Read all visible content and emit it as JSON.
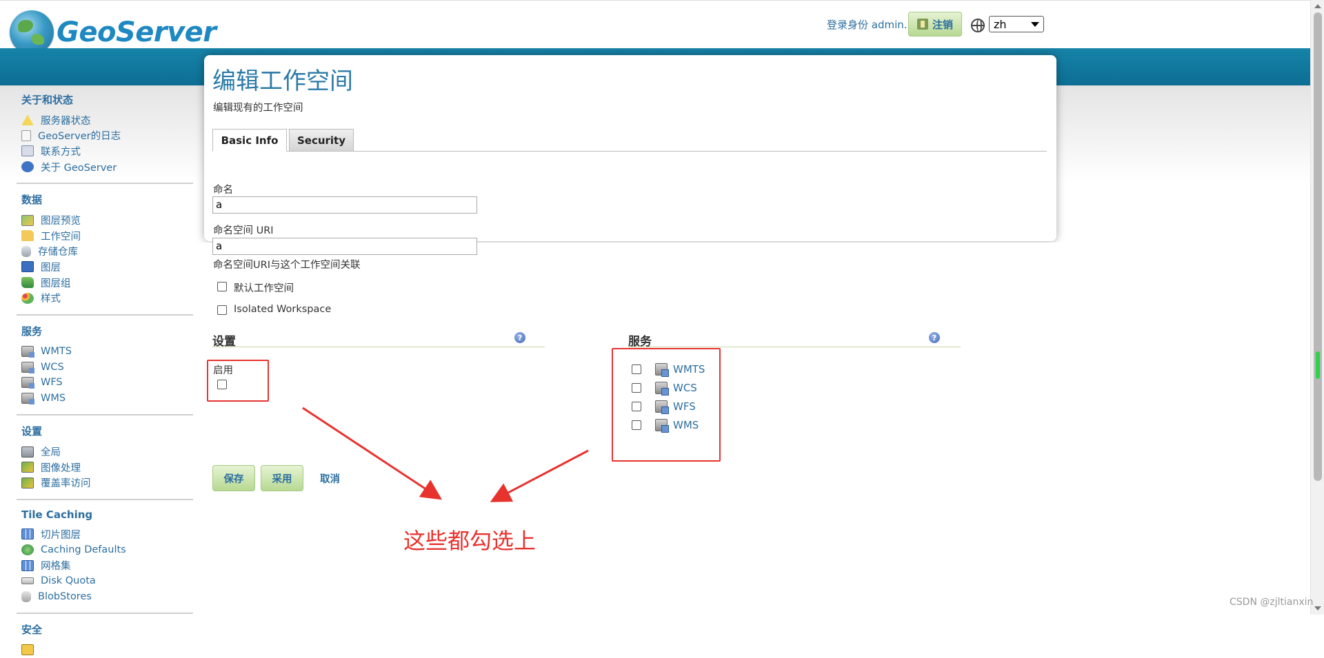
{
  "header": {
    "logo_text": "GeoServer",
    "login_text": "登录身份 admin.",
    "logout_label": "注销",
    "language_value": "zh"
  },
  "sidebar": {
    "sections": [
      {
        "title": "关于和状态",
        "items": [
          {
            "label": "服务器状态",
            "icon": "warning-icon"
          },
          {
            "label": "GeoServer的日志",
            "icon": "document-icon"
          },
          {
            "label": "联系方式",
            "icon": "contact-card-icon"
          },
          {
            "label": "关于 GeoServer",
            "icon": "info-icon"
          }
        ]
      },
      {
        "title": "数据",
        "items": [
          {
            "label": "图层预览",
            "icon": "map-preview-icon"
          },
          {
            "label": "工作空间",
            "icon": "folder-icon"
          },
          {
            "label": "存储仓库",
            "icon": "database-icon"
          },
          {
            "label": "图层",
            "icon": "layer-icon"
          },
          {
            "label": "图层组",
            "icon": "layer-group-icon"
          },
          {
            "label": "样式",
            "icon": "palette-icon"
          }
        ]
      },
      {
        "title": "服务",
        "items": [
          {
            "label": "WMTS",
            "icon": "service-icon"
          },
          {
            "label": "WCS",
            "icon": "service-icon"
          },
          {
            "label": "WFS",
            "icon": "service-icon"
          },
          {
            "label": "WMS",
            "icon": "service-icon"
          }
        ]
      },
      {
        "title": "设置",
        "items": [
          {
            "label": "全局",
            "icon": "server-icon"
          },
          {
            "label": "图像处理",
            "icon": "image-icon"
          },
          {
            "label": "覆盖率访问",
            "icon": "image-icon"
          }
        ]
      },
      {
        "title": "Tile Caching",
        "items": [
          {
            "label": "切片图层",
            "icon": "grid-icon"
          },
          {
            "label": "Caching Defaults",
            "icon": "globe-icon"
          },
          {
            "label": "网格集",
            "icon": "grid-icon"
          },
          {
            "label": "Disk Quota",
            "icon": "disk-icon"
          },
          {
            "label": "BlobStores",
            "icon": "cylinder-icon"
          }
        ]
      },
      {
        "title": "安全",
        "items": []
      }
    ]
  },
  "main": {
    "title": "编辑工作空间",
    "description": "编辑现有的工作空间",
    "tabs": [
      {
        "label": "Basic Info"
      },
      {
        "label": "Security"
      }
    ],
    "name_label": "命名",
    "name_value": "a",
    "uri_label": "命名空间 URI",
    "uri_value": "a",
    "uri_help": "命名空间URI与这个工作空间关联",
    "default_ws_label": "默认工作空间",
    "isolated_label": "Isolated Workspace",
    "settings_title": "设置",
    "enabled_label": "启用",
    "services_title": "服务",
    "services": [
      {
        "label": "WMTS"
      },
      {
        "label": "WCS"
      },
      {
        "label": "WFS"
      },
      {
        "label": "WMS"
      }
    ],
    "save_label": "保存",
    "apply_label": "采用",
    "cancel_label": "取消"
  },
  "annotation": {
    "text": "这些都勾选上",
    "color": "#e8322e"
  },
  "watermark": "CSDN @zjltianxin"
}
